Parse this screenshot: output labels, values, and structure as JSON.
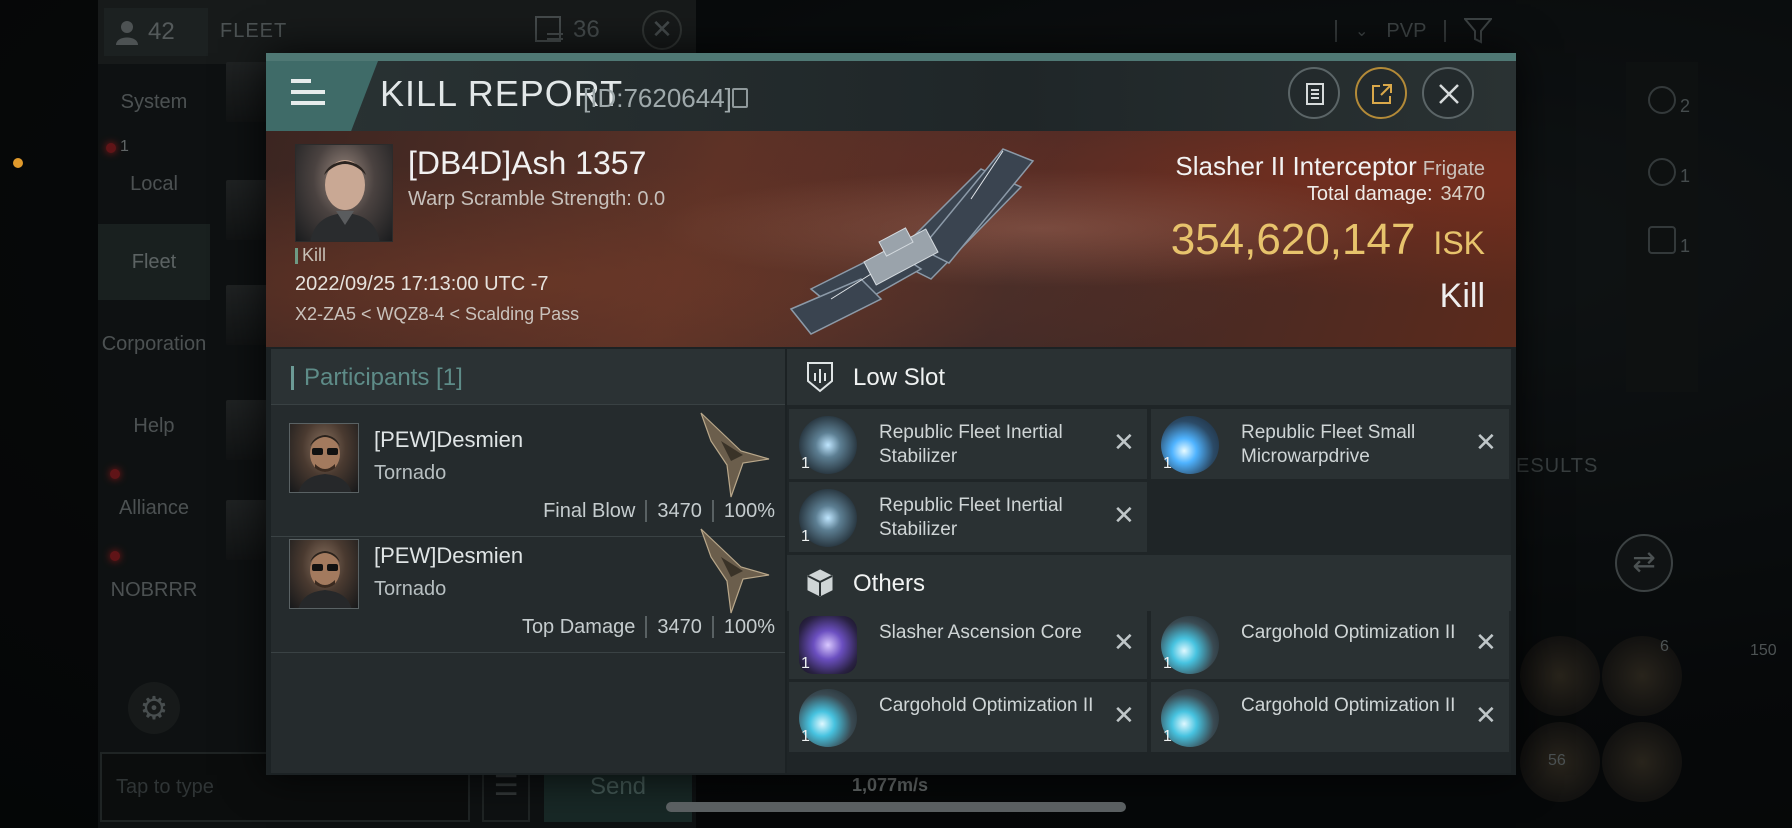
{
  "background": {
    "chat": {
      "member_count": "42",
      "title": "FLEET",
      "message_count": "36",
      "nav": [
        {
          "label": "System"
        },
        {
          "label": "Local",
          "badge": "1"
        },
        {
          "label": "Fleet"
        },
        {
          "label": "Corporation"
        },
        {
          "label": "Help"
        },
        {
          "label": "Alliance"
        },
        {
          "label": "NOBRRR"
        }
      ],
      "input_placeholder": "Tap to type",
      "send_label": "Send"
    },
    "filter_label": "PVP",
    "results_label": "ESULTS",
    "side_counts": [
      "2",
      "1",
      "1"
    ],
    "slot_counts": {
      "a": "6",
      "b": "56",
      "c": "150"
    },
    "speed": "1,077m/s"
  },
  "modal": {
    "title": "KILL REPORT",
    "report_id": "[ID:7620644]",
    "victim": {
      "name": "[DB4D]Ash 1357",
      "warp_scramble": "Warp Scramble Strength: 0.0",
      "tag": "Kill",
      "datetime": "2022/09/25 17:13:00 UTC -7",
      "location": "X2-ZA5 < WQZ8-4 < Scalding Pass"
    },
    "ship": {
      "name": "Slasher II Interceptor",
      "class": "Frigate",
      "total_damage_label": "Total damage:",
      "total_damage": "3470",
      "isk_value": "354,620,147",
      "isk_unit": "ISK",
      "result": "Kill"
    },
    "participants": {
      "header": "Participants [1]",
      "rows": [
        {
          "name": "[PEW]Desmien",
          "ship": "Tornado",
          "role": "Final Blow",
          "damage": "3470",
          "percent": "100%"
        },
        {
          "name": "[PEW]Desmien",
          "ship": "Tornado",
          "role": "Top Damage",
          "damage": "3470",
          "percent": "100%"
        }
      ]
    },
    "low_slot": {
      "title": "Low Slot",
      "modules": [
        {
          "name": "Republic Fleet Inertial Stabilizer",
          "qty": "1",
          "icon": "inertial-stabilizer-icon"
        },
        {
          "name": "Republic Fleet Small Microwarpdrive",
          "qty": "1",
          "icon": "microwarpdrive-icon"
        },
        {
          "name": "Republic Fleet Inertial Stabilizer",
          "qty": "1",
          "icon": "inertial-stabilizer-icon"
        }
      ]
    },
    "others": {
      "title": "Others",
      "modules": [
        {
          "name": "Slasher Ascension Core",
          "qty": "1",
          "icon": "ascension-core-icon"
        },
        {
          "name": "Cargohold Optimization II",
          "qty": "1",
          "icon": "cargohold-icon"
        },
        {
          "name": "Cargohold Optimization II",
          "qty": "1",
          "icon": "cargohold-icon"
        },
        {
          "name": "Cargohold Optimization II",
          "qty": "1",
          "icon": "cargohold-icon"
        }
      ]
    },
    "colors": {
      "accent": "#4f7874",
      "isk": "#e7c36c",
      "share_ring": "#b38a38"
    }
  }
}
